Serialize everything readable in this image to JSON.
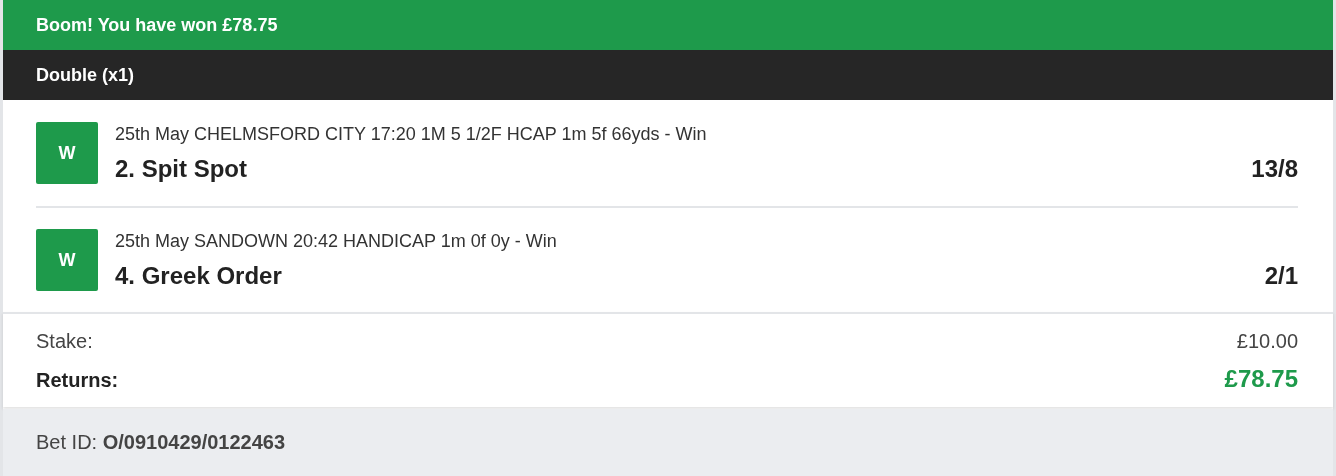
{
  "banner": {
    "text": "Boom! You have won £78.75"
  },
  "bet_type": {
    "text": "Double (x1)"
  },
  "legs": [
    {
      "result": "W",
      "description": "25th May CHELMSFORD CITY 17:20 1M 5 1/2F HCAP 1m 5f 66yds - Win",
      "selection": "2. Spit Spot",
      "odds": "13/8"
    },
    {
      "result": "W",
      "description": "25th May SANDOWN 20:42 HANDICAP 1m 0f 0y - Win",
      "selection": "4. Greek Order",
      "odds": "2/1"
    }
  ],
  "summary": {
    "stake_label": "Stake:",
    "stake": "£10.00",
    "returns_label": "Returns:",
    "returns": "£78.75"
  },
  "footer": {
    "bet_id": "Bet ID: **O/0910429/0122463**"
  }
}
